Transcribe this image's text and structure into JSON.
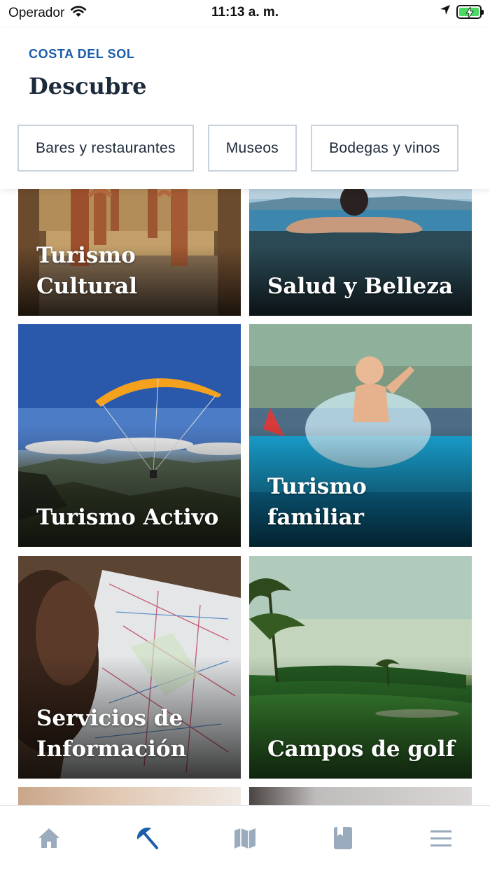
{
  "status_bar": {
    "carrier": "Operador",
    "time": "11:13 a. m.",
    "battery_level": 1.0,
    "battery_color": "#4cd964"
  },
  "header": {
    "region": "COSTA DEL SOL",
    "title": "Descubre",
    "region_color": "#1a5da8"
  },
  "filters": [
    "Bares y restaurantes",
    "Museos",
    "Bodegas y vinos"
  ],
  "cards": [
    {
      "label": "Turismo Cultural",
      "lines": [
        "Turismo",
        "Cultural"
      ],
      "image": "ancient-arches-photo"
    },
    {
      "label": "Salud y Belleza",
      "lines": [
        "Salud y Belleza"
      ],
      "image": "infinity-pool-photo"
    },
    {
      "label": "Turismo Activo",
      "lines": [
        "Turismo Activo"
      ],
      "image": "paraglider-photo"
    },
    {
      "label": "Turismo familiar",
      "lines": [
        "Turismo familiar"
      ],
      "image": "child-pool-splash-photo"
    },
    {
      "label": "Servicios de Información",
      "lines": [
        "Servicios de",
        "Información"
      ],
      "image": "road-map-photo"
    },
    {
      "label": "Campos de golf",
      "lines": [
        "Campos de golf"
      ],
      "image": "golf-course-photo"
    }
  ],
  "tabbar": {
    "items": [
      {
        "icon": "home-icon",
        "active": false
      },
      {
        "icon": "beach-umbrella-icon",
        "active": true
      },
      {
        "icon": "map-icon",
        "active": false
      },
      {
        "icon": "bookmark-icon",
        "active": false
      },
      {
        "icon": "menu-icon",
        "active": false
      }
    ],
    "active_color": "#1a5da8",
    "inactive_color": "#9aabbd"
  }
}
